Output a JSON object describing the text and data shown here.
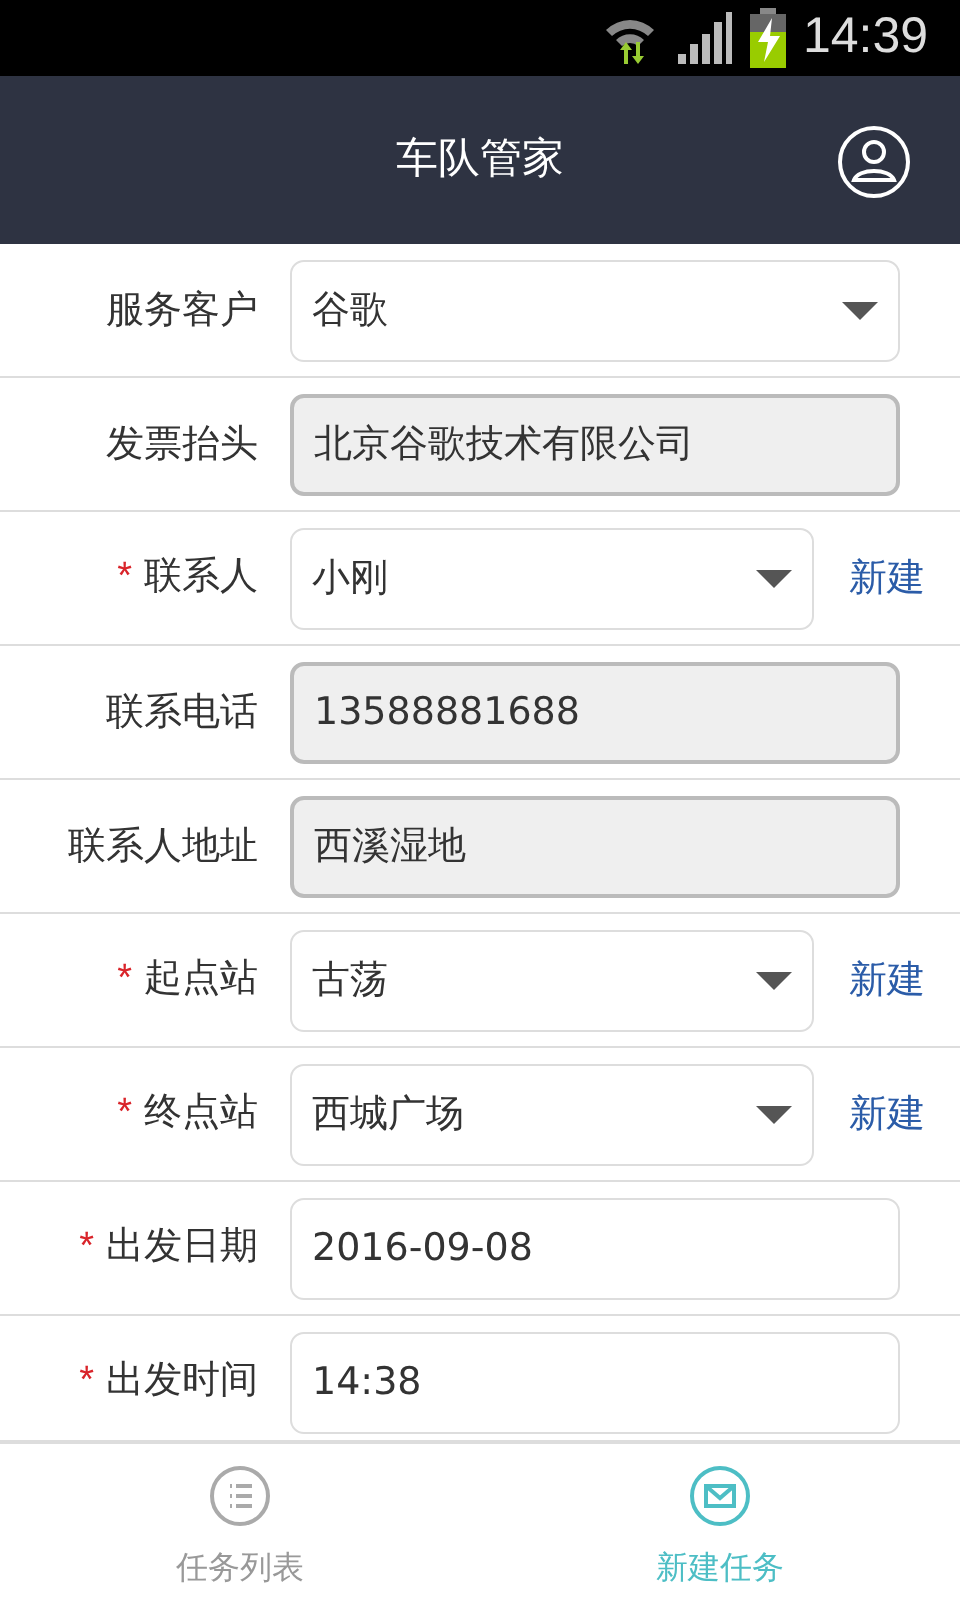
{
  "status_bar": {
    "time": "14:39"
  },
  "header": {
    "title": "车队管家"
  },
  "form": [
    {
      "label": "服务客户",
      "kind": "select",
      "value": "谷歌"
    },
    {
      "label": "发票抬头",
      "kind": "readonly",
      "value": "北京谷歌技术有限公司"
    },
    {
      "label": "联系人",
      "required_mark": "*",
      "kind": "select",
      "value": "小刚",
      "action": "新建"
    },
    {
      "label": "联系电话",
      "kind": "readonly",
      "value": "13588881688"
    },
    {
      "label": "联系人地址",
      "kind": "readonly",
      "value": "西溪湿地"
    },
    {
      "label": "起点站",
      "required_mark": "*",
      "kind": "select",
      "value": "古荡",
      "action": "新建"
    },
    {
      "label": "终点站",
      "required_mark": "*",
      "kind": "select",
      "value": "西城广场",
      "action": "新建"
    },
    {
      "label": "出发日期",
      "required_mark": "*",
      "kind": "input",
      "value": "2016-09-08"
    },
    {
      "label": "出发时间",
      "required_mark": "*",
      "kind": "input",
      "value": "14:38"
    }
  ],
  "tabs": [
    {
      "label": "任务列表",
      "selected": false
    },
    {
      "label": "新建任务",
      "selected": true
    }
  ]
}
